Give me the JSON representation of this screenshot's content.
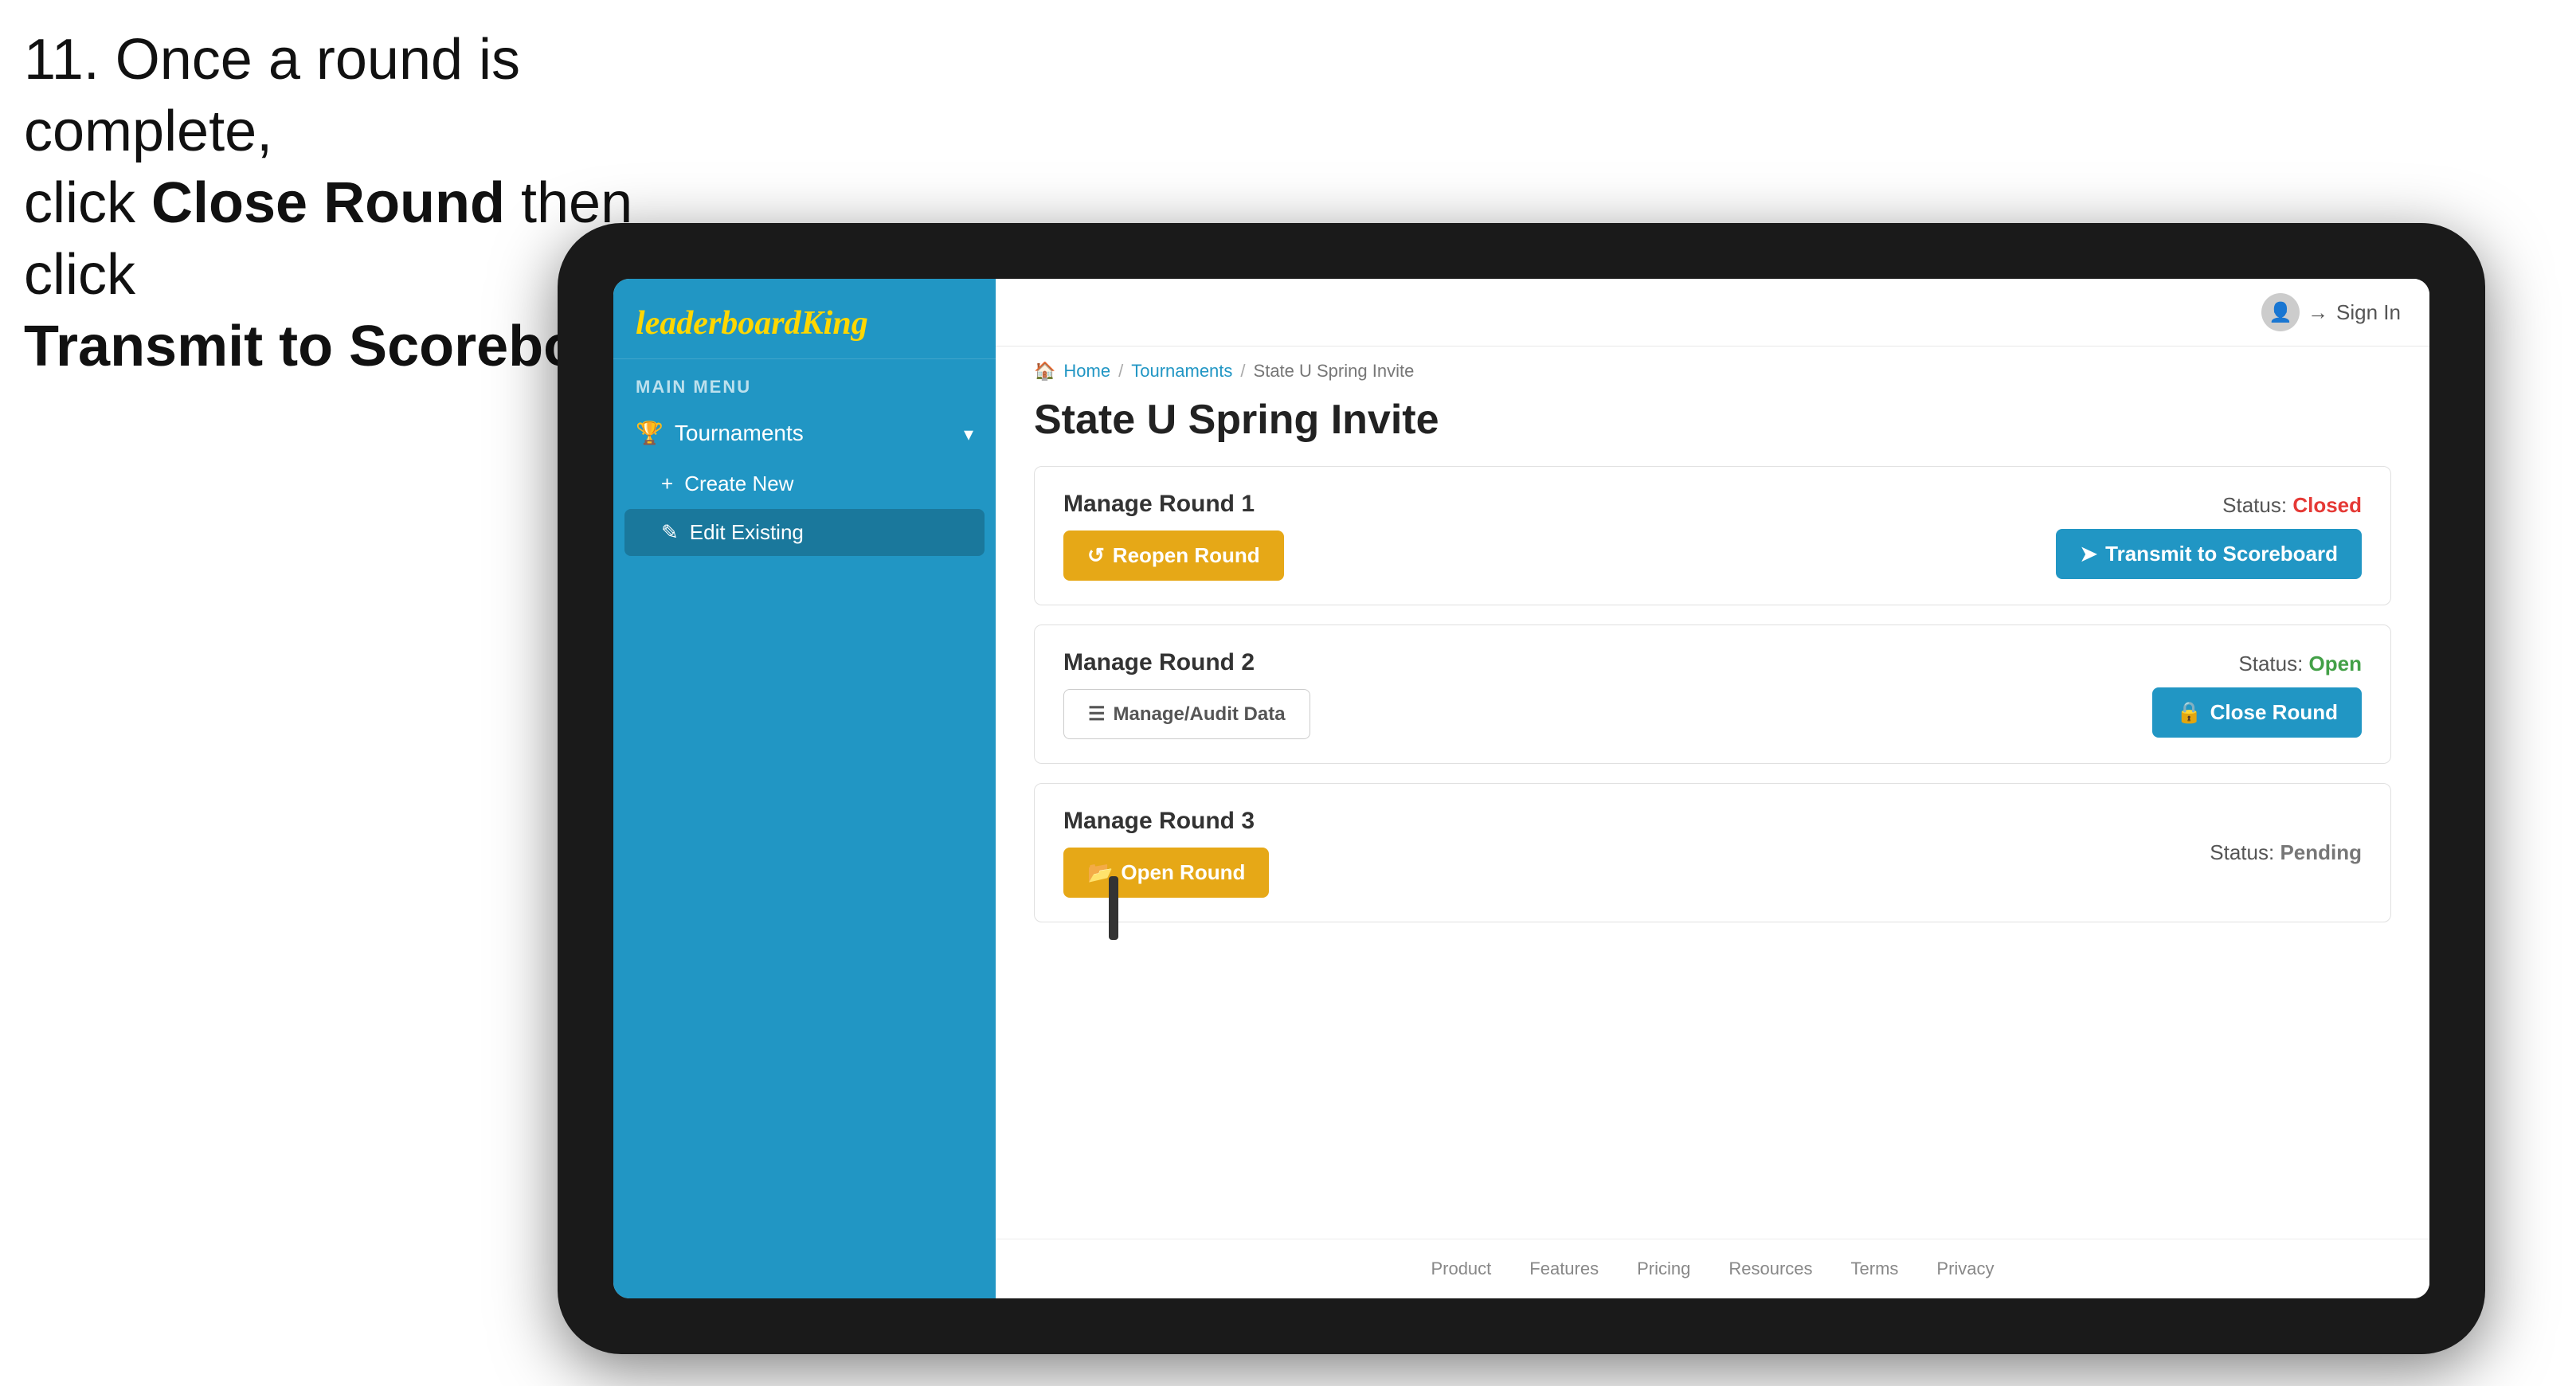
{
  "instruction": {
    "line1": "11. Once a round is complete,",
    "line2": "click ",
    "bold1": "Close Round",
    "line3": " then click",
    "bold2": "Transmit to Scoreboard."
  },
  "app": {
    "logo": {
      "text1": "leaderboard",
      "text2": "King"
    },
    "sidebar": {
      "menu_label": "MAIN MENU",
      "tournaments_label": "Tournaments",
      "create_new_label": "Create New",
      "edit_existing_label": "Edit Existing"
    },
    "topbar": {
      "sign_in": "Sign In"
    },
    "breadcrumb": {
      "home": "Home",
      "sep1": "/",
      "tournaments": "Tournaments",
      "sep2": "/",
      "current": "State U Spring Invite"
    },
    "page_title": "State U Spring Invite",
    "rounds": [
      {
        "title": "Manage Round 1",
        "status_label": "Status:",
        "status_value": "Closed",
        "status_class": "status-closed",
        "btn1_label": "Reopen Round",
        "btn1_class": "btn-gold",
        "btn2_label": "Transmit to Scoreboard",
        "btn2_class": "btn-blue"
      },
      {
        "title": "Manage Round 2",
        "status_label": "Status:",
        "status_value": "Open",
        "status_class": "status-open",
        "btn1_label": "Manage/Audit Data",
        "btn1_class": "btn-outline",
        "btn2_label": "Close Round",
        "btn2_class": "btn-blue"
      },
      {
        "title": "Manage Round 3",
        "status_label": "Status:",
        "status_value": "Pending",
        "status_class": "status-pending",
        "btn1_label": "Open Round",
        "btn1_class": "btn-gold",
        "btn2_label": null,
        "btn2_class": null
      }
    ],
    "footer": {
      "links": [
        "Product",
        "Features",
        "Pricing",
        "Resources",
        "Terms",
        "Privacy"
      ]
    }
  }
}
